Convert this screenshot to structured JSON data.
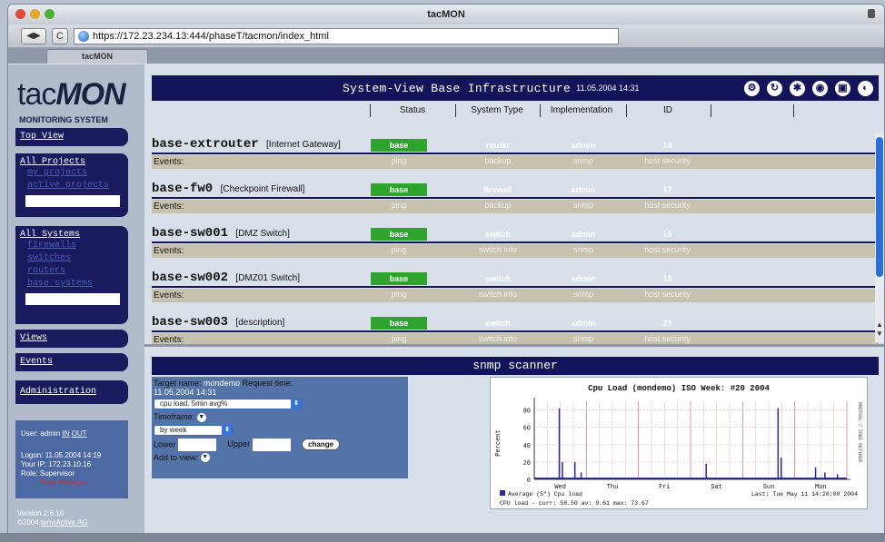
{
  "window": {
    "title": "tacMON"
  },
  "toolbar": {
    "back": "◀",
    "forward": "▶",
    "reload": "C",
    "url": "https://172.23.234.13:444/phaseT/tacmon/index_html"
  },
  "tab": {
    "label": "tacMON"
  },
  "logo": {
    "normal": "tac",
    "bold": "MON",
    "sub": "MONITORING SYSTEM"
  },
  "nav": {
    "top_view": "Top View",
    "all_projects": "All Projects",
    "projects_sub": [
      "my projects",
      "active projects"
    ],
    "all_systems": "All Systems",
    "systems_sub": [
      "firewalls",
      "switches",
      "routers",
      "base systems"
    ],
    "views": "Views",
    "events": "Events",
    "administration": "Administration"
  },
  "user": {
    "user_label": "User:",
    "user_name": "admin",
    "in": "IN",
    "out": "OUT",
    "logon": "Logon: 11.05.2004 14:19",
    "ip": "Your IP: 172.23.10.16",
    "role": "Role: Supervisor",
    "zope": "- Zope Manager -"
  },
  "version": {
    "line1": "Version 2.6.10",
    "line2_prefix": "©2004",
    "line2_link": "terraActive AG"
  },
  "header": {
    "title": "System-View Base Infrastructure",
    "datetime": "11.05.2004 14:31",
    "columns": [
      "Status",
      "System Type",
      "Implementation",
      "ID"
    ]
  },
  "systems": [
    {
      "name": "base-extrouter",
      "desc": "[Internet Gateway]",
      "status": "base",
      "type": "router",
      "impl": "admin",
      "id": "14",
      "events_label": "Events:",
      "events": [
        "ping",
        "backup",
        "snmp",
        "host security"
      ]
    },
    {
      "name": "base-fw0",
      "desc": "[Checkpoint Firewall]",
      "status": "base",
      "type": "firewall",
      "impl": "admin",
      "id": "17",
      "events_label": "Events:",
      "events": [
        "ping",
        "backup",
        "snmp",
        "host security"
      ]
    },
    {
      "name": "base-sw001",
      "desc": "[DMZ Switch]",
      "status": "base",
      "type": "switch",
      "impl": "admin",
      "id": "16",
      "events_label": "Events:",
      "events": [
        "ping",
        "switch info",
        "snmp",
        "host security"
      ]
    },
    {
      "name": "base-sw002",
      "desc": "[DMZ01 Switch]",
      "status": "base",
      "type": "switch",
      "impl": "admin",
      "id": "18",
      "events_label": "Events:",
      "events": [
        "ping",
        "switch info",
        "snmp",
        "host security"
      ]
    },
    {
      "name": "base-sw003",
      "desc": "[description]",
      "status": "base",
      "type": "switch",
      "impl": "admin",
      "id": "23",
      "events_label": "Events:",
      "events": [
        "ping",
        "switch info",
        "snmp",
        "host security"
      ]
    }
  ],
  "snmp": {
    "title": "snmp scanner",
    "target_label": "Target name:",
    "target_value": "mondemo",
    "request_label": "Request time:",
    "request_value": "11.05.2004 14:31",
    "metric": "cpu load, 5min avg%",
    "timeframe_label": "Timeframe:",
    "timeframe": "by week",
    "lower": "Lower",
    "upper": "Upper",
    "change": "change",
    "add_view": "Add to view:"
  },
  "chart_data": {
    "type": "area",
    "title": "Cpu Load (mondemo) ISO Week: #20 2004",
    "ylabel": "Percent",
    "right_label": "RRDTOOL / TOBI OETIKER",
    "categories": [
      "Wed",
      "Thu",
      "Fri",
      "Sat",
      "Sun",
      "Mon"
    ],
    "ylim": [
      0,
      90
    ],
    "yticks": [
      0,
      20,
      40,
      60,
      80
    ],
    "series": [
      {
        "name": "Average (5\") Cpu load",
        "color": "#2a2a9e"
      }
    ],
    "spikes": [
      {
        "x": 0.08,
        "v": 82
      },
      {
        "x": 0.09,
        "v": 20
      },
      {
        "x": 0.13,
        "v": 20
      },
      {
        "x": 0.15,
        "v": 8
      },
      {
        "x": 0.55,
        "v": 18
      },
      {
        "x": 0.78,
        "v": 82
      },
      {
        "x": 0.79,
        "v": 25
      },
      {
        "x": 0.9,
        "v": 14
      },
      {
        "x": 0.93,
        "v": 8
      },
      {
        "x": 0.97,
        "v": 6
      }
    ],
    "baseline": 2,
    "legend": "Average (5\") Cpu load",
    "stats": "CPU load - curr: 58.50   av: 9.61   max: 73.67",
    "last": "Last: Tue May 11 14:26:00 2004"
  }
}
